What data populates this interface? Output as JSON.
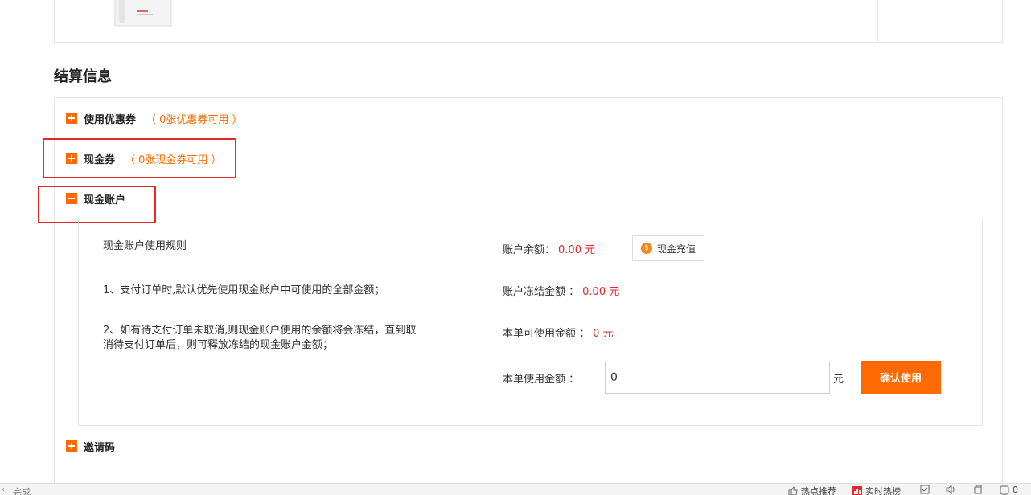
{
  "section": {
    "title": "结算信息"
  },
  "coupon": {
    "label": "使用优惠券",
    "hint": "（ 0张优惠券可用 ）"
  },
  "cash_coupon": {
    "label": "现金券",
    "hint": "（ 0张现金券可用 ）"
  },
  "cash_account": {
    "label": "现金账户",
    "rules_title": "现金账户使用规则",
    "rules": [
      "1、支付订单时,默认优先使用现金账户中可使用的全部金额；",
      "2、如有待支付订单未取消,则现金账户使用的余额将会冻结，直到取消待支付订单后，则可释放冻结的现金账户金额；"
    ],
    "balance_label": "账户余额：",
    "balance_value": "0.00 元",
    "recharge_label": "现金充值",
    "frozen_label": "账户冻结金额 ：",
    "frozen_value": "0.00 元",
    "available_label": "本单可使用金额 ：",
    "available_value": "0 元",
    "use_label": "本单使用金额 ：",
    "use_input_value": "0",
    "unit": "元",
    "confirm_label": "确认使用"
  },
  "invite": {
    "label": "邀请码"
  },
  "statusbar": {
    "status": "完成",
    "items": [
      "热点推荐",
      "实时热榜"
    ],
    "zoom_label": "0"
  },
  "colors": {
    "accent": "#ff6a00",
    "alert": "#e8272d"
  }
}
